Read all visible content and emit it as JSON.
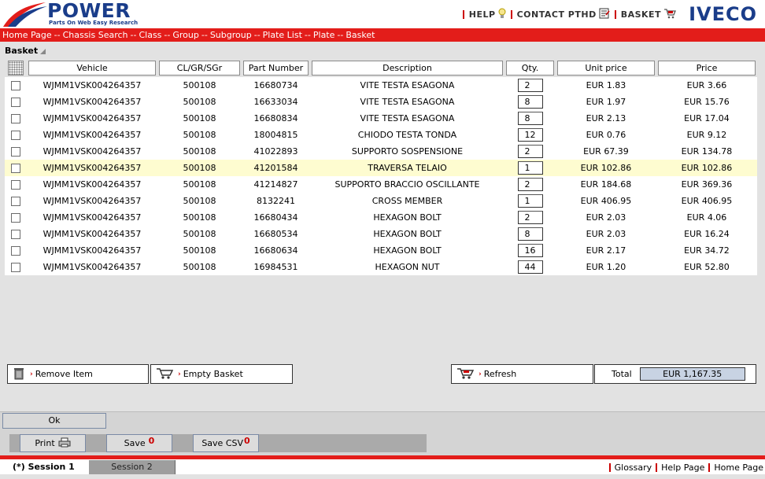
{
  "brand": {
    "logo_text": "POWER",
    "logo_subtext": "Parts On Web Easy Research",
    "right_brand": "IVECO"
  },
  "toplinks": {
    "help": "HELP",
    "contact": "CONTACT PTHD",
    "basket": "BASKET"
  },
  "breadcrumb": [
    "Home Page",
    "Chassis Search",
    "Class",
    "Group",
    "Subgroup",
    "Plate List",
    "Plate",
    "Basket"
  ],
  "breadcrumb_separator": "--",
  "section_title": "Basket",
  "table": {
    "headers": {
      "vehicle": "Vehicle",
      "clgrsgr": "CL/GR/SGr",
      "part_number": "Part Number",
      "description": "Description",
      "qty": "Qty.",
      "unit_price": "Unit price",
      "price": "Price"
    },
    "rows": [
      {
        "vehicle": "WJMM1VSK004264357",
        "code": "500108",
        "part": "16680734",
        "desc": "VITE TESTA ESAGONA",
        "qty": "2",
        "unit": "EUR 1.83",
        "price": "EUR 3.66",
        "highlight": false
      },
      {
        "vehicle": "WJMM1VSK004264357",
        "code": "500108",
        "part": "16633034",
        "desc": "VITE TESTA ESAGONA",
        "qty": "8",
        "unit": "EUR 1.97",
        "price": "EUR 15.76",
        "highlight": false
      },
      {
        "vehicle": "WJMM1VSK004264357",
        "code": "500108",
        "part": "16680834",
        "desc": "VITE TESTA ESAGONA",
        "qty": "8",
        "unit": "EUR 2.13",
        "price": "EUR 17.04",
        "highlight": false
      },
      {
        "vehicle": "WJMM1VSK004264357",
        "code": "500108",
        "part": "18004815",
        "desc": "CHIODO TESTA TONDA",
        "qty": "12",
        "unit": "EUR 0.76",
        "price": "EUR 9.12",
        "highlight": false
      },
      {
        "vehicle": "WJMM1VSK004264357",
        "code": "500108",
        "part": "41022893",
        "desc": "SUPPORTO SOSPENSIONE",
        "qty": "2",
        "unit": "EUR 67.39",
        "price": "EUR 134.78",
        "highlight": false
      },
      {
        "vehicle": "WJMM1VSK004264357",
        "code": "500108",
        "part": "41201584",
        "desc": "TRAVERSA TELAIO",
        "qty": "1",
        "unit": "EUR 102.86",
        "price": "EUR 102.86",
        "highlight": true
      },
      {
        "vehicle": "WJMM1VSK004264357",
        "code": "500108",
        "part": "41214827",
        "desc": "SUPPORTO BRACCIO OSCILLANTE",
        "qty": "2",
        "unit": "EUR 184.68",
        "price": "EUR 369.36",
        "highlight": false
      },
      {
        "vehicle": "WJMM1VSK004264357",
        "code": "500108",
        "part": "8132241",
        "desc": "CROSS MEMBER",
        "qty": "1",
        "unit": "EUR 406.95",
        "price": "EUR 406.95",
        "highlight": false
      },
      {
        "vehicle": "WJMM1VSK004264357",
        "code": "500108",
        "part": "16680434",
        "desc": "HEXAGON BOLT",
        "qty": "2",
        "unit": "EUR 2.03",
        "price": "EUR 4.06",
        "highlight": false
      },
      {
        "vehicle": "WJMM1VSK004264357",
        "code": "500108",
        "part": "16680534",
        "desc": "HEXAGON BOLT",
        "qty": "8",
        "unit": "EUR 2.03",
        "price": "EUR 16.24",
        "highlight": false
      },
      {
        "vehicle": "WJMM1VSK004264357",
        "code": "500108",
        "part": "16680634",
        "desc": "HEXAGON BOLT",
        "qty": "16",
        "unit": "EUR 2.17",
        "price": "EUR 34.72",
        "highlight": false
      },
      {
        "vehicle": "WJMM1VSK004264357",
        "code": "500108",
        "part": "16984531",
        "desc": "HEXAGON NUT",
        "qty": "44",
        "unit": "EUR 1.20",
        "price": "EUR 52.80",
        "highlight": false
      }
    ]
  },
  "actions": {
    "remove_item": "Remove Item",
    "empty_basket": "Empty Basket",
    "refresh": "Refresh",
    "total_label": "Total",
    "total_value": "EUR 1,167.35"
  },
  "ok_label": "Ok",
  "toolbar": {
    "print": "Print",
    "save": "Save",
    "save_csv": "Save CSV"
  },
  "sessions": {
    "active": "(*) Session 1",
    "inactive": "Session 2"
  },
  "footer_links": [
    "Glossary",
    "Help Page",
    "Home Page"
  ],
  "colors": {
    "accent_red": "#e31d1a",
    "brand_blue": "#1a3d8a",
    "highlight_row": "#fefcd0",
    "total_bg": "#c8d3e3"
  }
}
